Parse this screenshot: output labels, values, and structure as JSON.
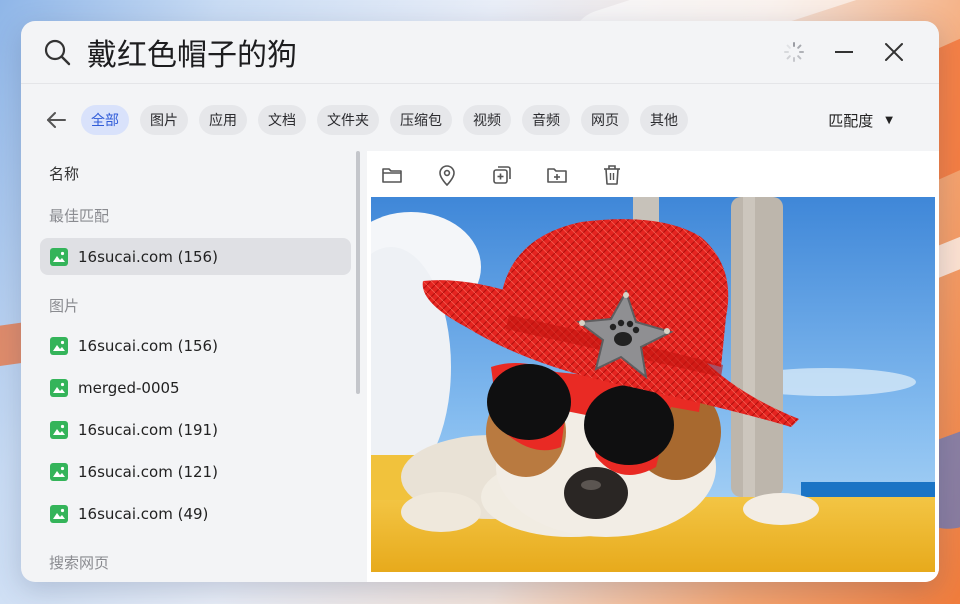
{
  "search": {
    "query": "戴红色帽子的狗"
  },
  "filters": [
    "全部",
    "图片",
    "应用",
    "文档",
    "文件夹",
    "压缩包",
    "视频",
    "音频",
    "网页",
    "其他"
  ],
  "sort_label": "匹配度",
  "list": {
    "column_header": "名称",
    "best_match_title": "最佳匹配",
    "best_match": "16sucai.com (156)",
    "images_title": "图片",
    "images": [
      "16sucai.com (156)",
      "merged-0005",
      "16sucai.com (191)",
      "16sucai.com (121)",
      "16sucai.com (49)"
    ],
    "web_title": "搜索网页"
  },
  "colors": {
    "accent": "#2f5bd8",
    "image_icon": "#34b45a",
    "hat": "#e8201e"
  },
  "icons": [
    "search-icon",
    "loading-icon",
    "minimize-icon",
    "close-icon",
    "back-arrow-icon",
    "folder-icon",
    "location-pin-icon",
    "copy-icon",
    "move-to-folder-icon",
    "trash-icon"
  ]
}
